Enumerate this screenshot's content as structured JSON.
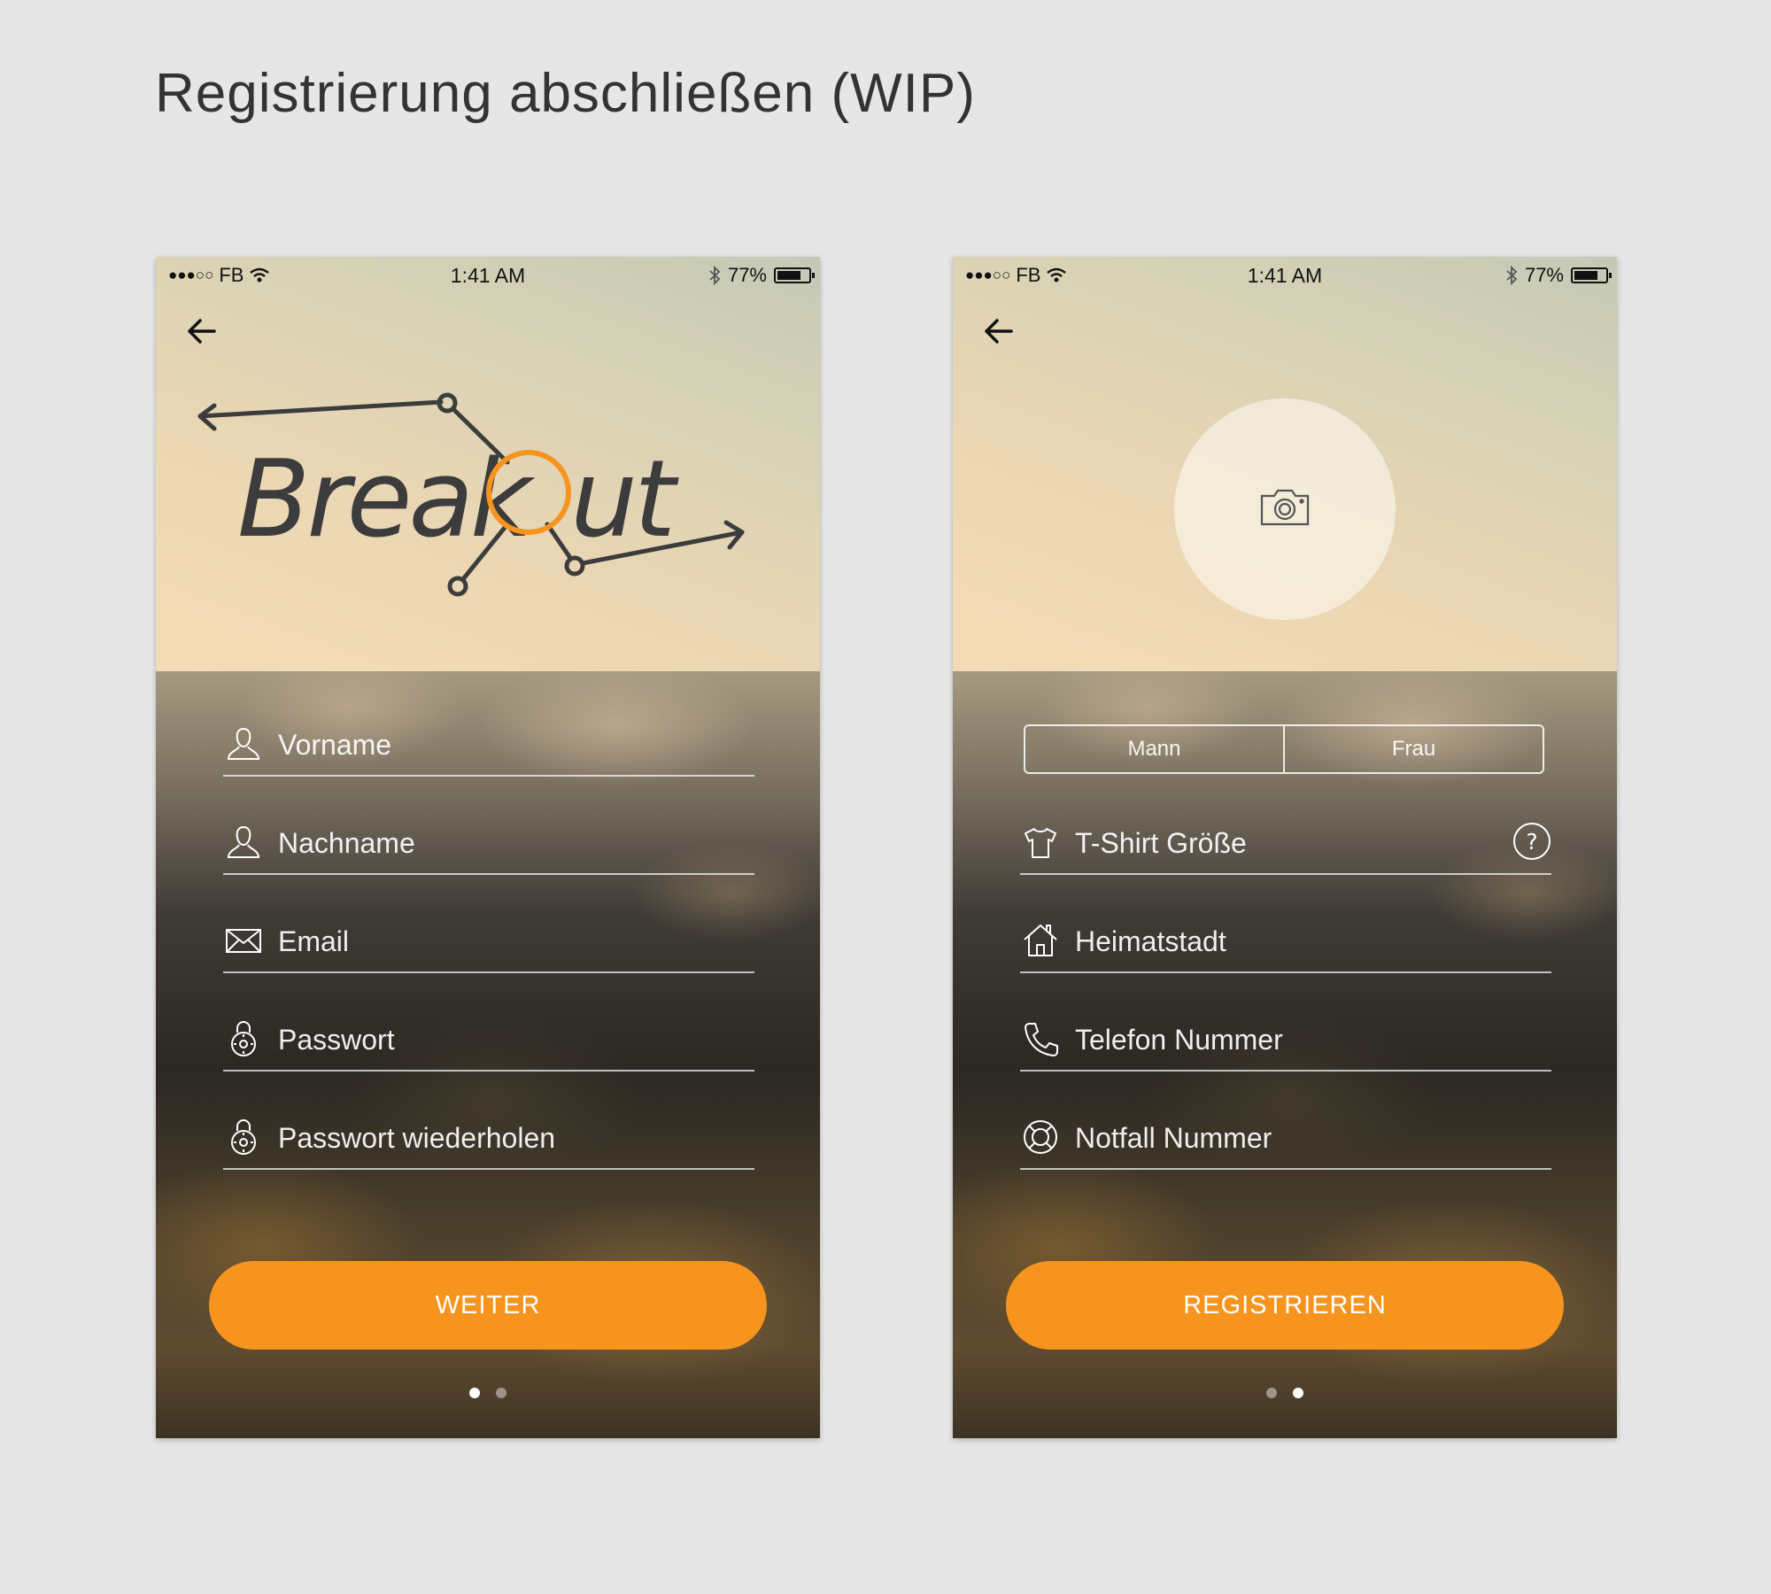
{
  "page": {
    "title": "Registrierung abschließen (WIP)"
  },
  "colors": {
    "accent": "#f7941d",
    "background": "#e6e6e6",
    "text_on_photo": "#ffffff"
  },
  "status_bar": {
    "signal": "●●●○○",
    "carrier": "FB",
    "time": "1:41 AM",
    "battery_percent": "77%",
    "battery_level": 0.77
  },
  "screen1": {
    "logo_text": "BreakOut",
    "fields": [
      {
        "icon": "person-icon",
        "placeholder": "Vorname"
      },
      {
        "icon": "person-icon",
        "placeholder": "Nachname"
      },
      {
        "icon": "envelope-icon",
        "placeholder": "Email"
      },
      {
        "icon": "lock-icon",
        "placeholder": "Passwort"
      },
      {
        "icon": "lock-icon",
        "placeholder": "Passwort wiederholen"
      }
    ],
    "button_label": "WEITER",
    "pager": {
      "total": 2,
      "active": 1
    }
  },
  "screen2": {
    "gender_options": [
      "Mann",
      "Frau"
    ],
    "fields": [
      {
        "icon": "tshirt-icon",
        "placeholder": "T-Shirt Größe",
        "help": "?"
      },
      {
        "icon": "house-icon",
        "placeholder": "Heimatstadt"
      },
      {
        "icon": "phone-icon",
        "placeholder": "Telefon Nummer"
      },
      {
        "icon": "lifebuoy-icon",
        "placeholder": "Notfall Nummer"
      }
    ],
    "button_label": "REGISTRIEREN",
    "pager": {
      "total": 2,
      "active": 2
    }
  }
}
